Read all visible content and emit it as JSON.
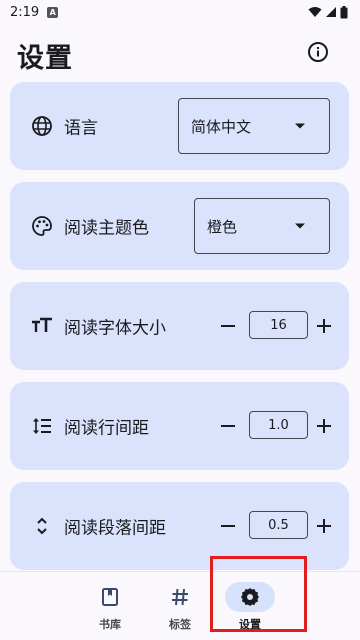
{
  "status_bar": {
    "time": "2:19",
    "notification_badge": "A"
  },
  "header": {
    "title": "设置"
  },
  "settings": {
    "language": {
      "label": "语言",
      "value": "简体中文"
    },
    "theme_color": {
      "label": "阅读主题色",
      "value": "橙色"
    },
    "font_size": {
      "label": "阅读字体大小",
      "value": "16"
    },
    "line_spacing": {
      "label": "阅读行间距",
      "value": "1.0"
    },
    "paragraph_spacing": {
      "label": "阅读段落间距",
      "value": "0.5"
    }
  },
  "bottom_nav": {
    "items": [
      {
        "label": "书库",
        "icon": "book-icon"
      },
      {
        "label": "标签",
        "icon": "hash-icon"
      },
      {
        "label": "设置",
        "icon": "gear-icon",
        "active": true
      }
    ]
  },
  "colors": {
    "accent": "#dae2fc",
    "active_pill": "#d6e1fb",
    "highlight": "#e01e1e"
  }
}
